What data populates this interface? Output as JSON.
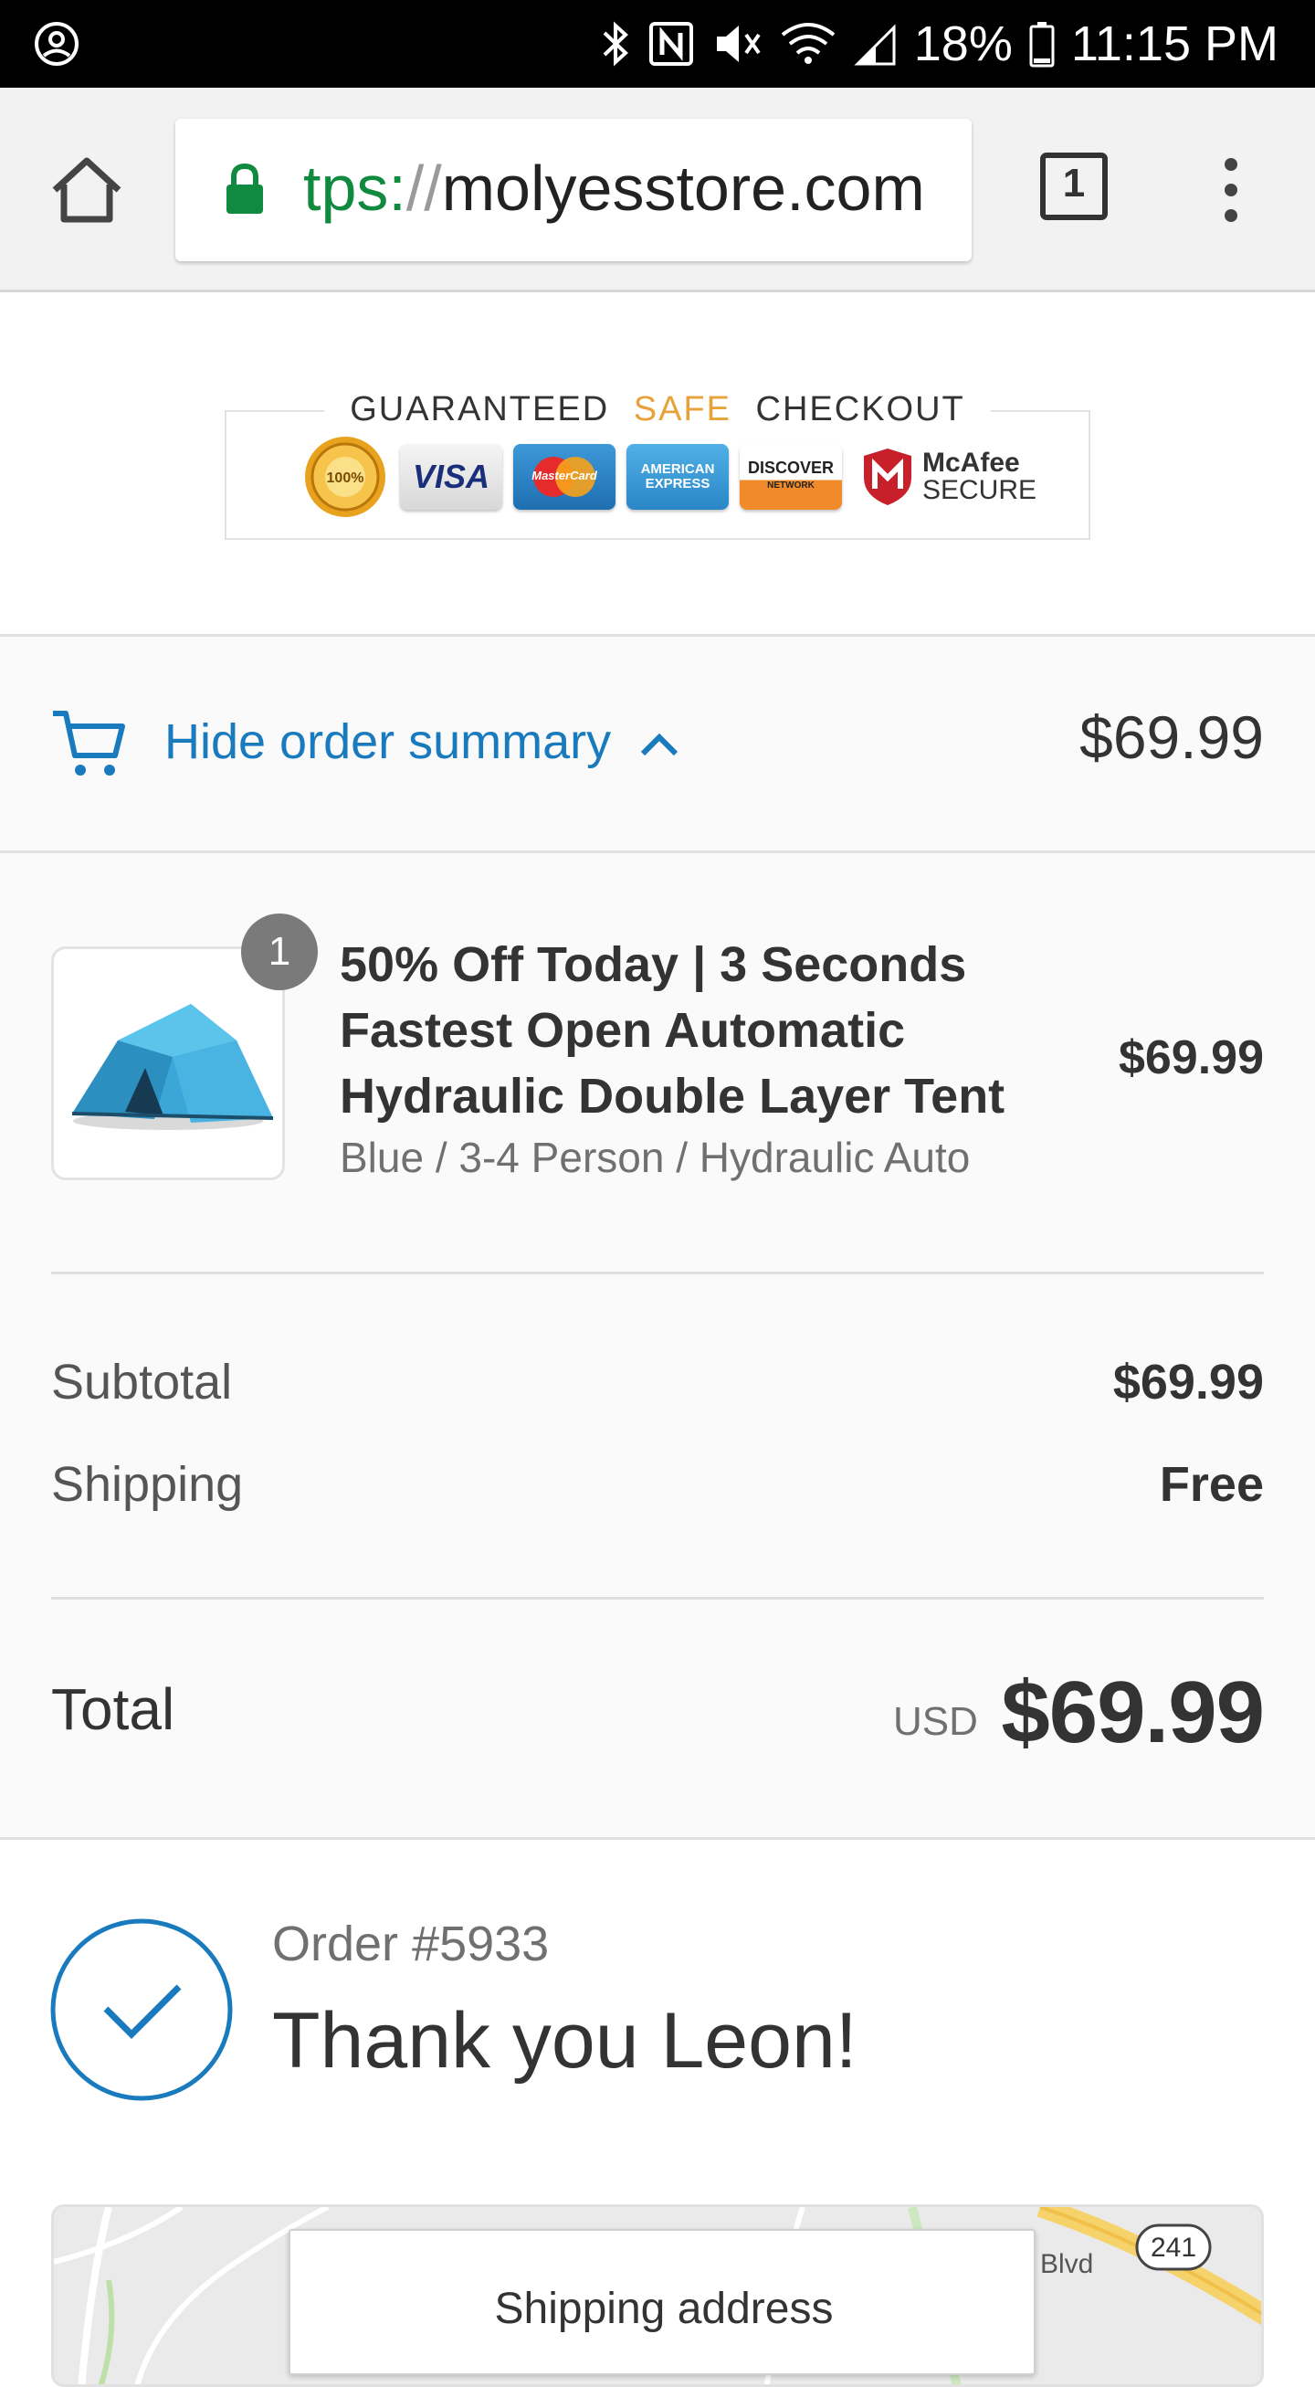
{
  "status_bar": {
    "battery": "18%",
    "time": "11:15 PM"
  },
  "browser": {
    "url_scheme": "tps:",
    "url_slashes": "//",
    "url_host": "molyesstore.com",
    "tab_count": "1"
  },
  "trust_badge": {
    "heading_pre": "GUARANTEED ",
    "heading_safe": "SAFE",
    "heading_post": " CHECKOUT",
    "seal_text": "100%",
    "cards": {
      "visa": "VISA",
      "mastercard": "MasterCard",
      "amex_line1": "AMERICAN",
      "amex_line2": "EXPRESS",
      "discover_line1": "DISCOVER",
      "discover_line2": "NETWORK"
    },
    "mcafee_line1": "McAfee",
    "mcafee_line2": "SECURE"
  },
  "summary_toggle": {
    "label": "Hide order summary",
    "price": "$69.99"
  },
  "order_summary": {
    "item": {
      "quantity": "1",
      "title": "50% Off Today | 3 Seconds Fastest Open Automatic Hydraulic Double Layer Tent",
      "variant": "Blue / 3-4 Person / Hydraulic Auto",
      "price": "$69.99"
    },
    "subtotal_label": "Subtotal",
    "subtotal_value": "$69.99",
    "shipping_label": "Shipping",
    "shipping_value": "Free",
    "total_label": "Total",
    "currency": "USD",
    "total_value": "$69.99"
  },
  "confirmation": {
    "order_number": "Order #5933",
    "thank_you": "Thank you Leon!"
  },
  "map": {
    "road_label": "Blvd",
    "route_number": "241"
  },
  "shipping_card": {
    "title": "Shipping address"
  },
  "colors": {
    "accent_blue": "#197bbd",
    "secure_green": "#0f8a3e",
    "safe_orange": "#e8a23a"
  }
}
